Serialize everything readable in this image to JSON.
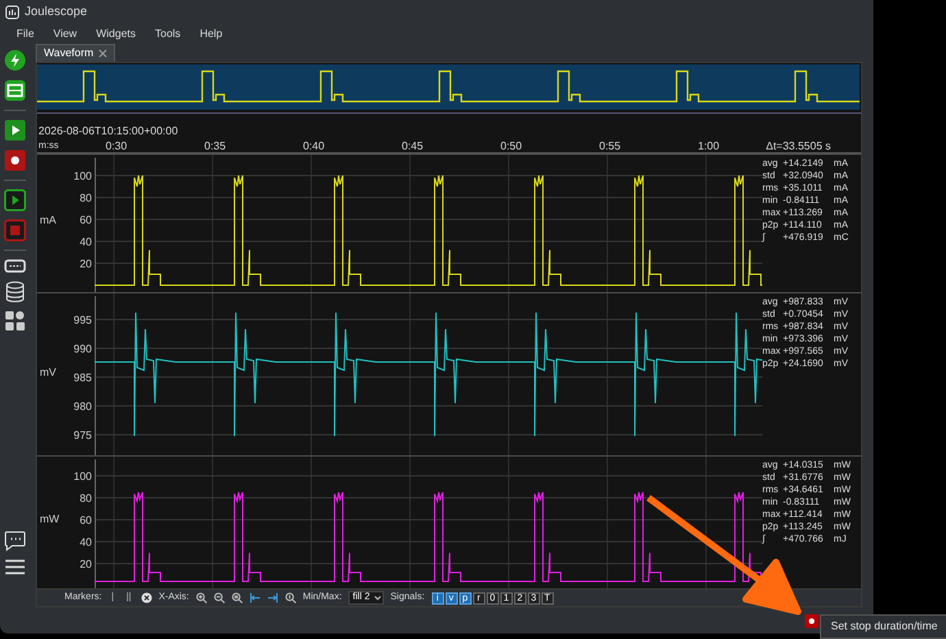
{
  "window": {
    "title": "Joulescope"
  },
  "menu": [
    "File",
    "View",
    "Widgets",
    "Tools",
    "Help"
  ],
  "tabs": [
    {
      "label": "Waveform",
      "selected": true
    }
  ],
  "timestamp": "2026-08-06T10:15:00+00:00",
  "time_axis": {
    "label": "m:ss",
    "ticks": [
      "0:30",
      "0:35",
      "0:40",
      "0:45",
      "0:50",
      "0:55",
      "1:00"
    ],
    "delta": "Δt=33.5505 s"
  },
  "plots": [
    {
      "kind": "current",
      "unit": "mA",
      "color": "#d8d818",
      "yticks": [
        "100",
        "80",
        "60",
        "40",
        "20"
      ],
      "stats": [
        {
          "label": "avg",
          "value": "+14.2149",
          "unit": "mA"
        },
        {
          "label": "std",
          "value": "+32.0940",
          "unit": "mA"
        },
        {
          "label": "rms",
          "value": "+35.1011",
          "unit": "mA"
        },
        {
          "label": "min",
          "value": "-0.84111",
          "unit": "mA"
        },
        {
          "label": "max",
          "value": "+113.269",
          "unit": "mA"
        },
        {
          "label": "p2p",
          "value": "+114.110",
          "unit": "mA"
        },
        {
          "label": "∫",
          "value": "+476.919",
          "unit": "mC"
        }
      ]
    },
    {
      "kind": "voltage",
      "unit": "mV",
      "color": "#20c0c0",
      "yticks": [
        "995",
        "990",
        "985",
        "980",
        "975"
      ],
      "stats": [
        {
          "label": "avg",
          "value": "+987.833",
          "unit": "mV"
        },
        {
          "label": "std",
          "value": "+0.70454",
          "unit": "mV"
        },
        {
          "label": "rms",
          "value": "+987.834",
          "unit": "mV"
        },
        {
          "label": "min",
          "value": "+973.396",
          "unit": "mV"
        },
        {
          "label": "max",
          "value": "+997.565",
          "unit": "mV"
        },
        {
          "label": "p2p",
          "value": "+24.1690",
          "unit": "mV"
        }
      ]
    },
    {
      "kind": "power",
      "unit": "mW",
      "color": "#e020e0",
      "yticks": [
        "100",
        "80",
        "60",
        "40",
        "20"
      ],
      "stats": [
        {
          "label": "avg",
          "value": "+14.0315",
          "unit": "mW"
        },
        {
          "label": "std",
          "value": "+31.6776",
          "unit": "mW"
        },
        {
          "label": "rms",
          "value": "+34.6461",
          "unit": "mW"
        },
        {
          "label": "min",
          "value": "-0.83111",
          "unit": "mW"
        },
        {
          "label": "max",
          "value": "+112.414",
          "unit": "mW"
        },
        {
          "label": "p2p",
          "value": "+113.245",
          "unit": "mW"
        },
        {
          "label": "∫",
          "value": "+470.766",
          "unit": "mJ"
        }
      ]
    }
  ],
  "toolbar": {
    "markers_label": "Markers:",
    "marker_buttons": [
      "|",
      "||"
    ],
    "xaxis_label": "X-Axis:",
    "minmax_label": "Min/Max:",
    "minmax_value": "fill 2",
    "signals_label": "Signals:",
    "signals": [
      {
        "label": "i",
        "selected": true
      },
      {
        "label": "v",
        "selected": true
      },
      {
        "label": "p",
        "selected": true
      },
      {
        "label": "r",
        "selected": false
      },
      {
        "label": "0",
        "selected": false
      },
      {
        "label": "1",
        "selected": false
      },
      {
        "label": "2",
        "selected": false
      },
      {
        "label": "3",
        "selected": false
      },
      {
        "label": "T",
        "selected": false
      }
    ]
  },
  "tooltip": "Set stop duration/time"
}
